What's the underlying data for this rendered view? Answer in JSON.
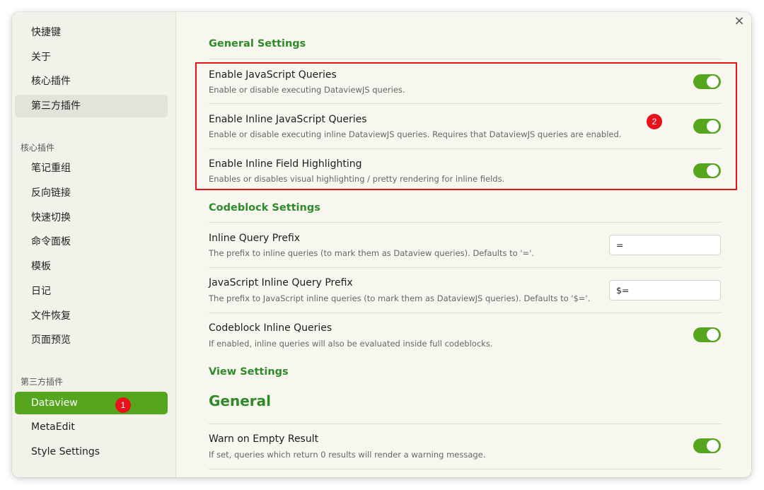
{
  "sidebar": {
    "top_items": [
      {
        "label": "快捷键"
      },
      {
        "label": "关于"
      },
      {
        "label": "核心插件"
      },
      {
        "label": "第三方插件"
      }
    ],
    "core_heading": "核心插件",
    "core_items": [
      {
        "label": "笔记重组"
      },
      {
        "label": "反向链接"
      },
      {
        "label": "快速切换"
      },
      {
        "label": "命令面板"
      },
      {
        "label": "模板"
      },
      {
        "label": "日记"
      },
      {
        "label": "文件恢复"
      },
      {
        "label": "页面预览"
      }
    ],
    "third_heading": "第三方插件",
    "third_items": [
      {
        "label": "Dataview"
      },
      {
        "label": "MetaEdit"
      },
      {
        "label": "Style Settings"
      }
    ]
  },
  "annotations": {
    "badge1": "1",
    "badge2": "2"
  },
  "close_label": "×",
  "content": {
    "general_settings": "General Settings",
    "codeblock_settings": "Codeblock Settings",
    "view_settings": "View Settings",
    "general": "General",
    "settings": [
      {
        "name": "Enable JavaScript Queries",
        "desc": "Enable or disable executing DataviewJS queries.",
        "enabled": true
      },
      {
        "name": "Enable Inline JavaScript Queries",
        "desc": "Enable or disable executing inline DataviewJS queries. Requires that DataviewJS queries are enabled.",
        "enabled": true
      },
      {
        "name": "Enable Inline Field Highlighting",
        "desc": "Enables or disables visual highlighting / pretty rendering for inline fields.",
        "enabled": true
      },
      {
        "name": "Inline Query Prefix",
        "desc": "The prefix to inline queries (to mark them as Dataview queries). Defaults to '='.",
        "value": "="
      },
      {
        "name": "JavaScript Inline Query Prefix",
        "desc": "The prefix to JavaScript inline queries (to mark them as DataviewJS queries). Defaults to '$='.",
        "value": "$="
      },
      {
        "name": "Codeblock Inline Queries",
        "desc": "If enabled, inline queries will also be evaluated inside full codeblocks.",
        "enabled": true
      },
      {
        "name": "Warn on Empty Result",
        "desc": "If set, queries which return 0 results will render a warning message.",
        "enabled": true
      }
    ]
  },
  "colors": {
    "accent": "#55a51e",
    "heading": "#2f8a2a",
    "annotation": "#e8121a"
  }
}
